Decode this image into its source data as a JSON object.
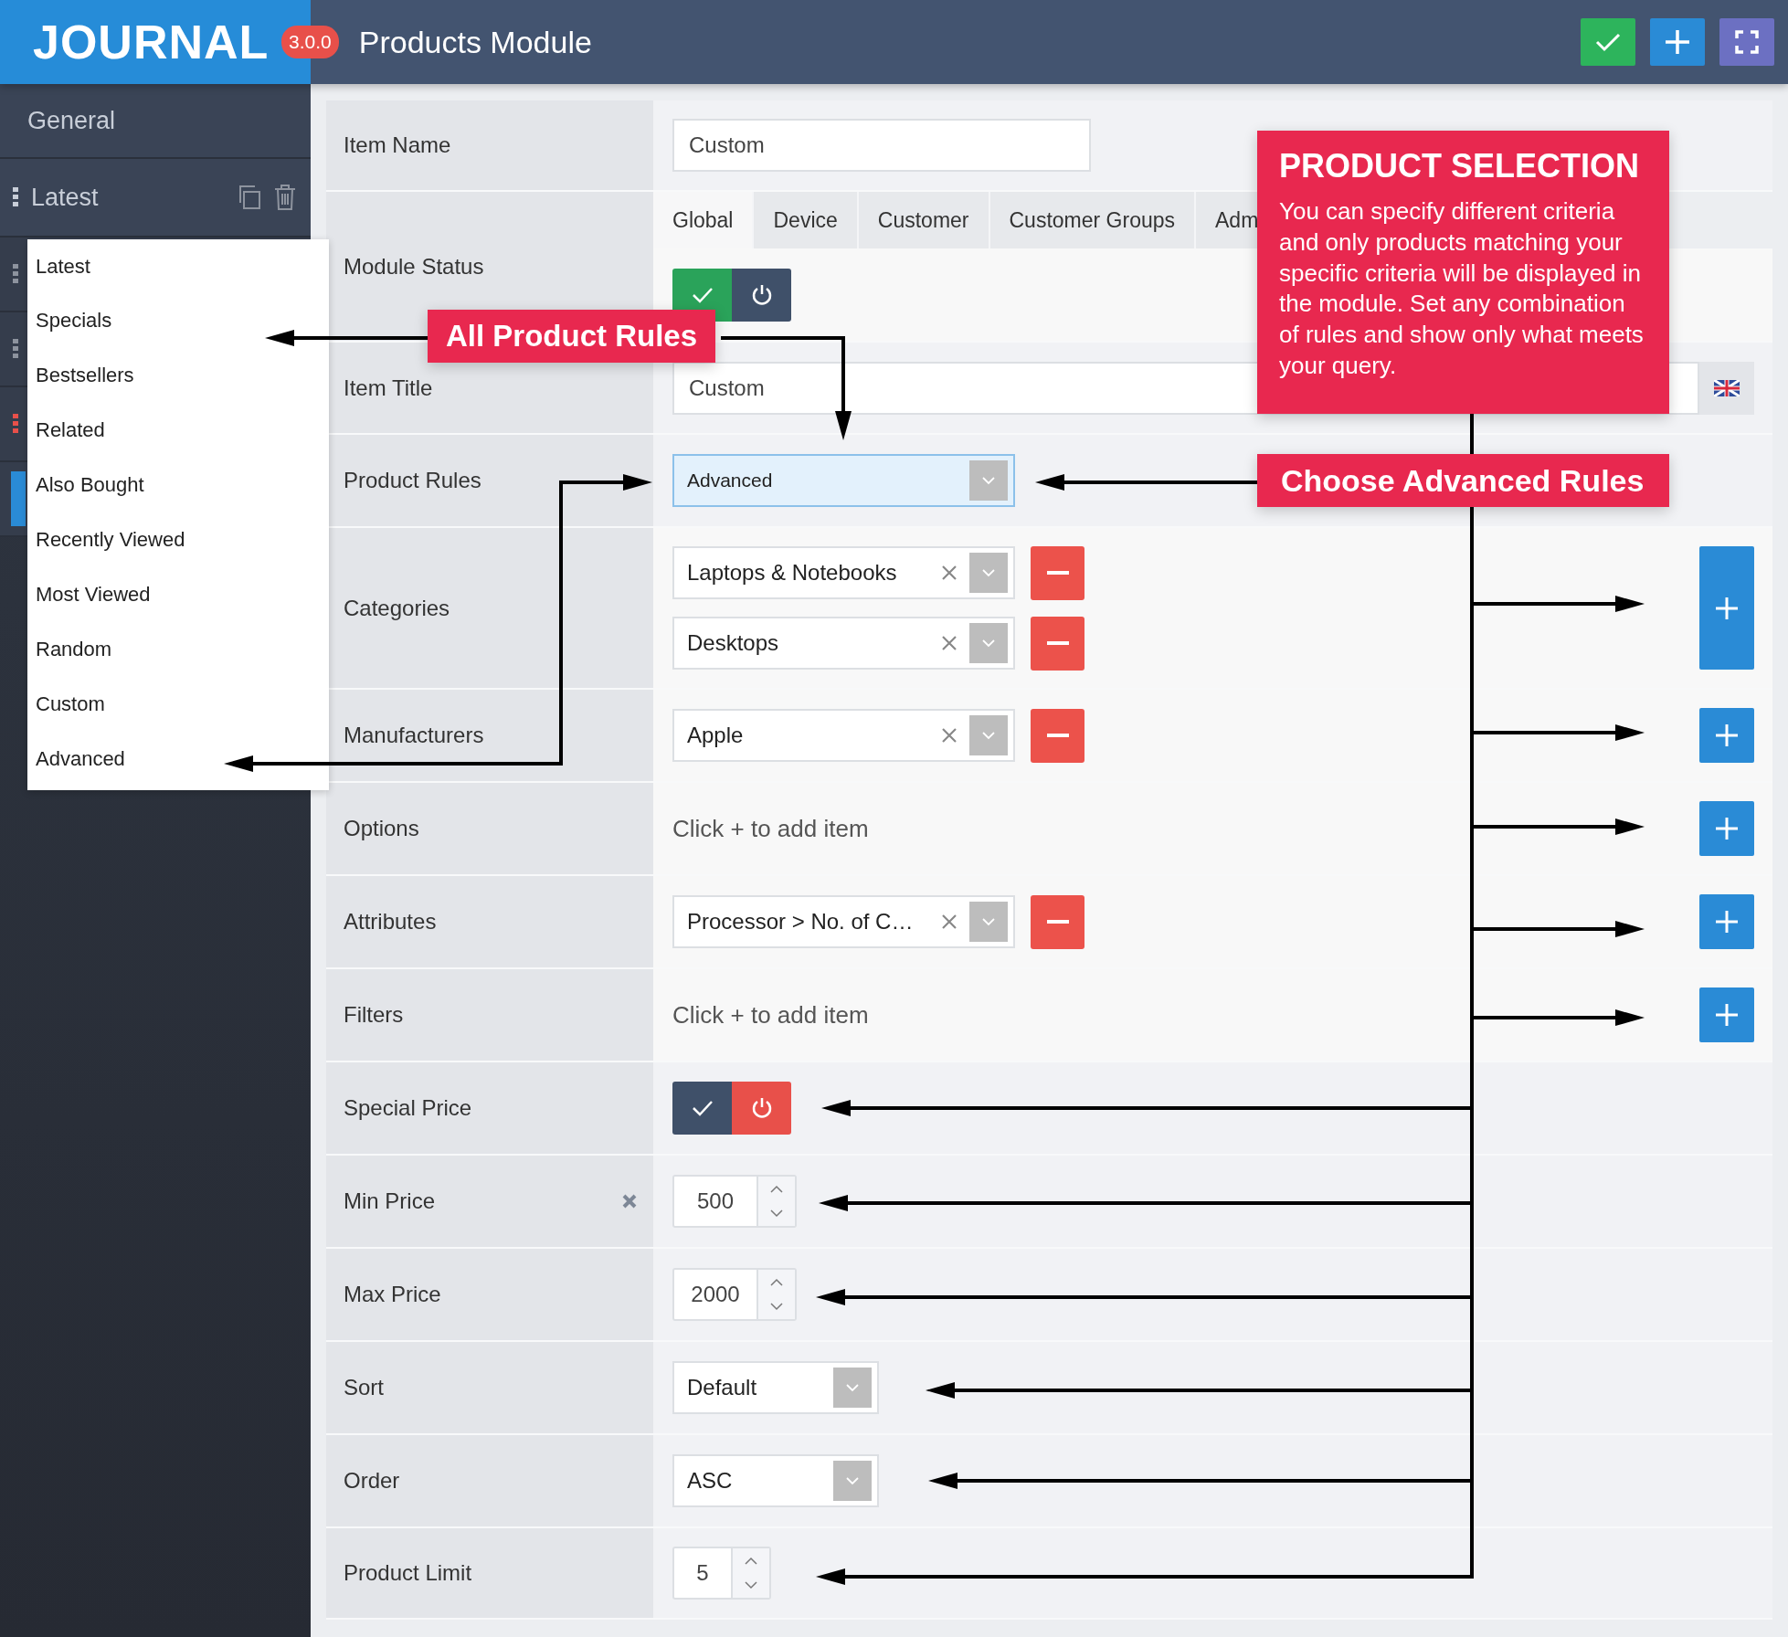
{
  "header": {
    "logo": "JOURNAL",
    "version": "3.0.0",
    "title": "Products Module"
  },
  "sidebar": {
    "section": "General",
    "module": "Latest",
    "handles": [
      {
        "kind": "dots",
        "color": "#8d939e"
      },
      {
        "kind": "dots",
        "color": "#8d939e"
      },
      {
        "kind": "dots",
        "color": "#e8504a"
      },
      {
        "kind": "bar",
        "color": "#2a8bd6"
      }
    ]
  },
  "dropdown": {
    "items": [
      {
        "label": "Latest",
        "selected": false
      },
      {
        "label": "Specials",
        "selected": false
      },
      {
        "label": "Bestsellers",
        "selected": false
      },
      {
        "label": "Related",
        "selected": false
      },
      {
        "label": "Also Bought",
        "selected": false
      },
      {
        "label": "Recently Viewed",
        "selected": false
      },
      {
        "label": "Most Viewed",
        "selected": false
      },
      {
        "label": "Random",
        "selected": false
      },
      {
        "label": "Custom",
        "selected": false
      },
      {
        "label": "Advanced",
        "selected": false
      }
    ]
  },
  "form": {
    "rows": [
      {
        "kind": "text",
        "label": "Item Name",
        "value": "Custom"
      },
      {
        "kind": "status",
        "label": "Module Status",
        "on": true,
        "tabs": [
          {
            "label": "Global",
            "selected": true
          },
          {
            "label": "Device",
            "selected": false
          },
          {
            "label": "Customer",
            "selected": false
          },
          {
            "label": "Customer Groups",
            "selected": false
          },
          {
            "label": "Adm",
            "selected": false
          }
        ]
      },
      {
        "kind": "text-flag",
        "label": "Item Title",
        "value": "Custom"
      },
      {
        "kind": "select",
        "label": "Product Rules",
        "value": "Advanced",
        "highlighted": true
      },
      {
        "kind": "multi",
        "label": "Categories",
        "items": [
          "Laptops & Notebooks",
          "Desktops"
        ]
      },
      {
        "kind": "multi",
        "label": "Manufacturers",
        "items": [
          "Apple"
        ]
      },
      {
        "kind": "multi",
        "label": "Options",
        "hint": "Click + to add item"
      },
      {
        "kind": "multi",
        "label": "Attributes",
        "items": [
          "Processor > No. of C…"
        ]
      },
      {
        "kind": "multi",
        "label": "Filters",
        "hint": "Click + to add item"
      },
      {
        "kind": "toggle",
        "label": "Special Price",
        "on": false
      },
      {
        "kind": "number",
        "label": "Min Price",
        "value": "500",
        "clearable": true
      },
      {
        "kind": "number",
        "label": "Max Price",
        "value": "2000"
      },
      {
        "kind": "select",
        "label": "Sort",
        "value": "Default",
        "highlighted": false
      },
      {
        "kind": "select",
        "label": "Order",
        "value": "ASC",
        "highlighted": false
      },
      {
        "kind": "number",
        "label": "Product Limit",
        "value": "5"
      }
    ]
  },
  "annotations": [
    {
      "kind": "tag",
      "text": "All Product Rules"
    },
    {
      "kind": "callout",
      "title": "PRODUCT SELECTION",
      "text": "You can specify different criteria and only products matching your specific criteria will be displayed in the module. Set any combination of rules and show only what meets your query."
    },
    {
      "kind": "tag",
      "text": "Choose Advanced Rules"
    }
  ]
}
